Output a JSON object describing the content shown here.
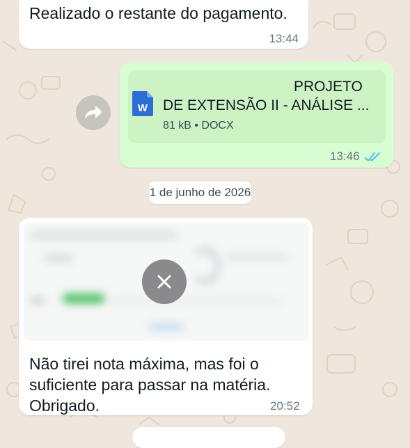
{
  "messages": [
    {
      "direction": "incoming",
      "text": "Realizado o restante do pagamento.",
      "time": "13:44"
    },
    {
      "direction": "outgoing",
      "forward_icon": "forward-arrow-icon",
      "document": {
        "name_line1": "PROJETO",
        "name_line2": "DE EXTENSÃO II - ANÁLISE ...",
        "meta": "81 kB • DOCX",
        "icon": "word-document-icon",
        "icon_letter": "W"
      },
      "time": "13:46",
      "status_icon": "double-check-icon"
    },
    {
      "direction": "incoming",
      "image": {
        "blurred": true,
        "cancel_icon": "close-icon"
      },
      "text_lines": [
        "Não tirei nota máxima, mas foi o",
        "suficiente para passar na matéria.",
        "Obrigado."
      ],
      "time": "20:52"
    }
  ],
  "date_separator": "1 de junho de 2026",
  "colors": {
    "background": "#efe7dd",
    "incoming_bubble": "#ffffff",
    "outgoing_bubble": "#d9fdd3",
    "read_check": "#53bdeb",
    "word_blue": "#2b6ed6"
  }
}
